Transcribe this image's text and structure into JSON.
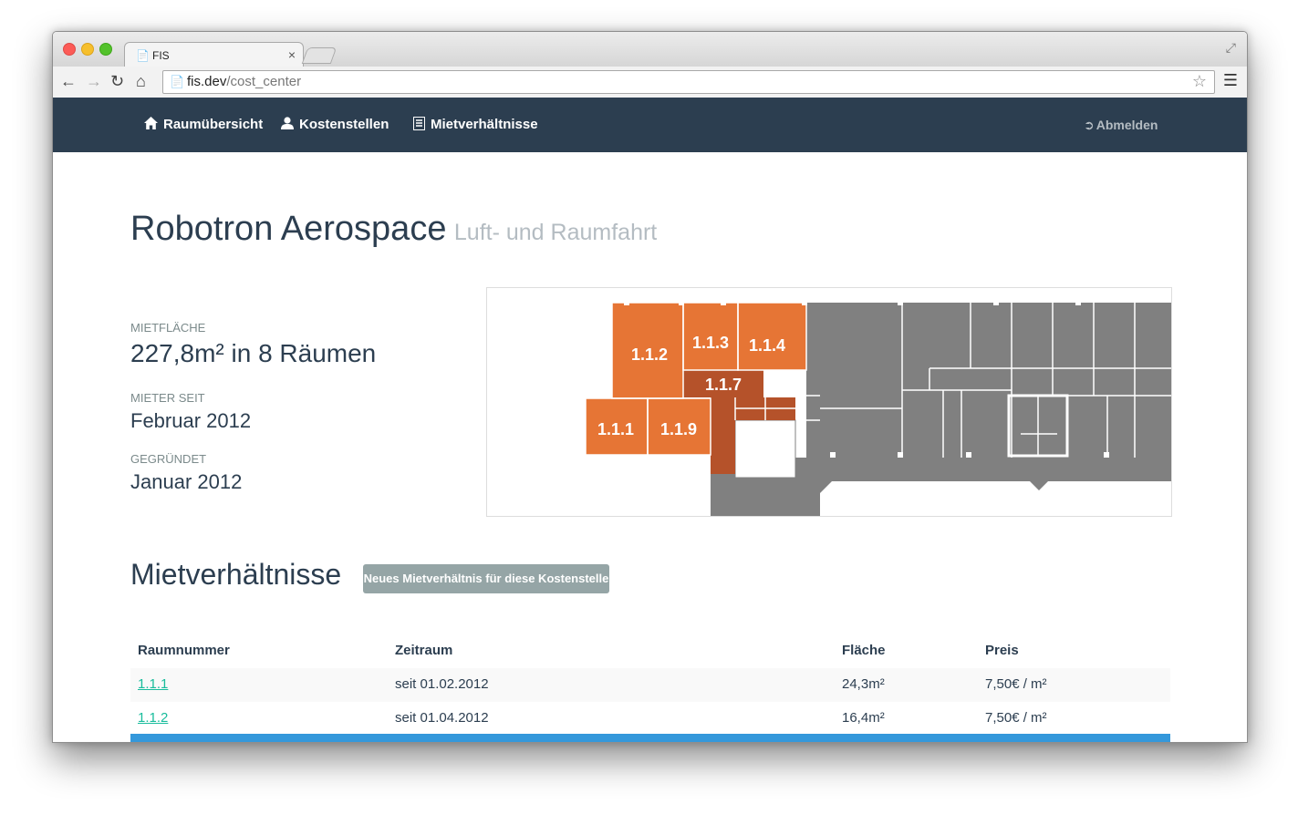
{
  "browser": {
    "tab_title": "FIS",
    "url_host": "fis.dev",
    "url_path": "/cost_center"
  },
  "nav": {
    "items": [
      {
        "label": "Raumübersicht",
        "icon": "home-icon"
      },
      {
        "label": "Kostenstellen",
        "icon": "user-icon"
      },
      {
        "label": "Mietverhältnisse",
        "icon": "list-icon"
      }
    ],
    "logout": "Abmelden"
  },
  "header": {
    "title": "Robotron Aerospace",
    "subtitle": "Luft- und Raumfahrt"
  },
  "details": {
    "area_label": "Mietfläche",
    "area_value": "227,8m² in 8 Räumen",
    "tenant_since_label": "Mieter seit",
    "tenant_since_value": "Februar 2012",
    "founded_label": "Gegründet",
    "founded_value": "Januar 2012"
  },
  "floorplan": {
    "rooms": [
      "1.1.1",
      "1.1.2",
      "1.1.3",
      "1.1.4",
      "1.1.7",
      "1.1.9"
    ],
    "colors": {
      "rented": "#e67535",
      "highlight": "#b5522a",
      "other": "#808080"
    }
  },
  "leases": {
    "title": "Mietverhältnisse",
    "new_button": "Neues Mietverhältnis für diese Kostenstelle",
    "columns": [
      "Raumnummer",
      "Zeitraum",
      "Fläche",
      "Preis"
    ],
    "rows": [
      {
        "room": "1.1.1",
        "period": "seit 01.02.2012",
        "area": "24,3m²",
        "price": "7,50€ / m²"
      },
      {
        "room": "1.1.2",
        "period": "seit 01.04.2012",
        "area": "16,4m²",
        "price": "7,50€ / m²"
      }
    ]
  }
}
